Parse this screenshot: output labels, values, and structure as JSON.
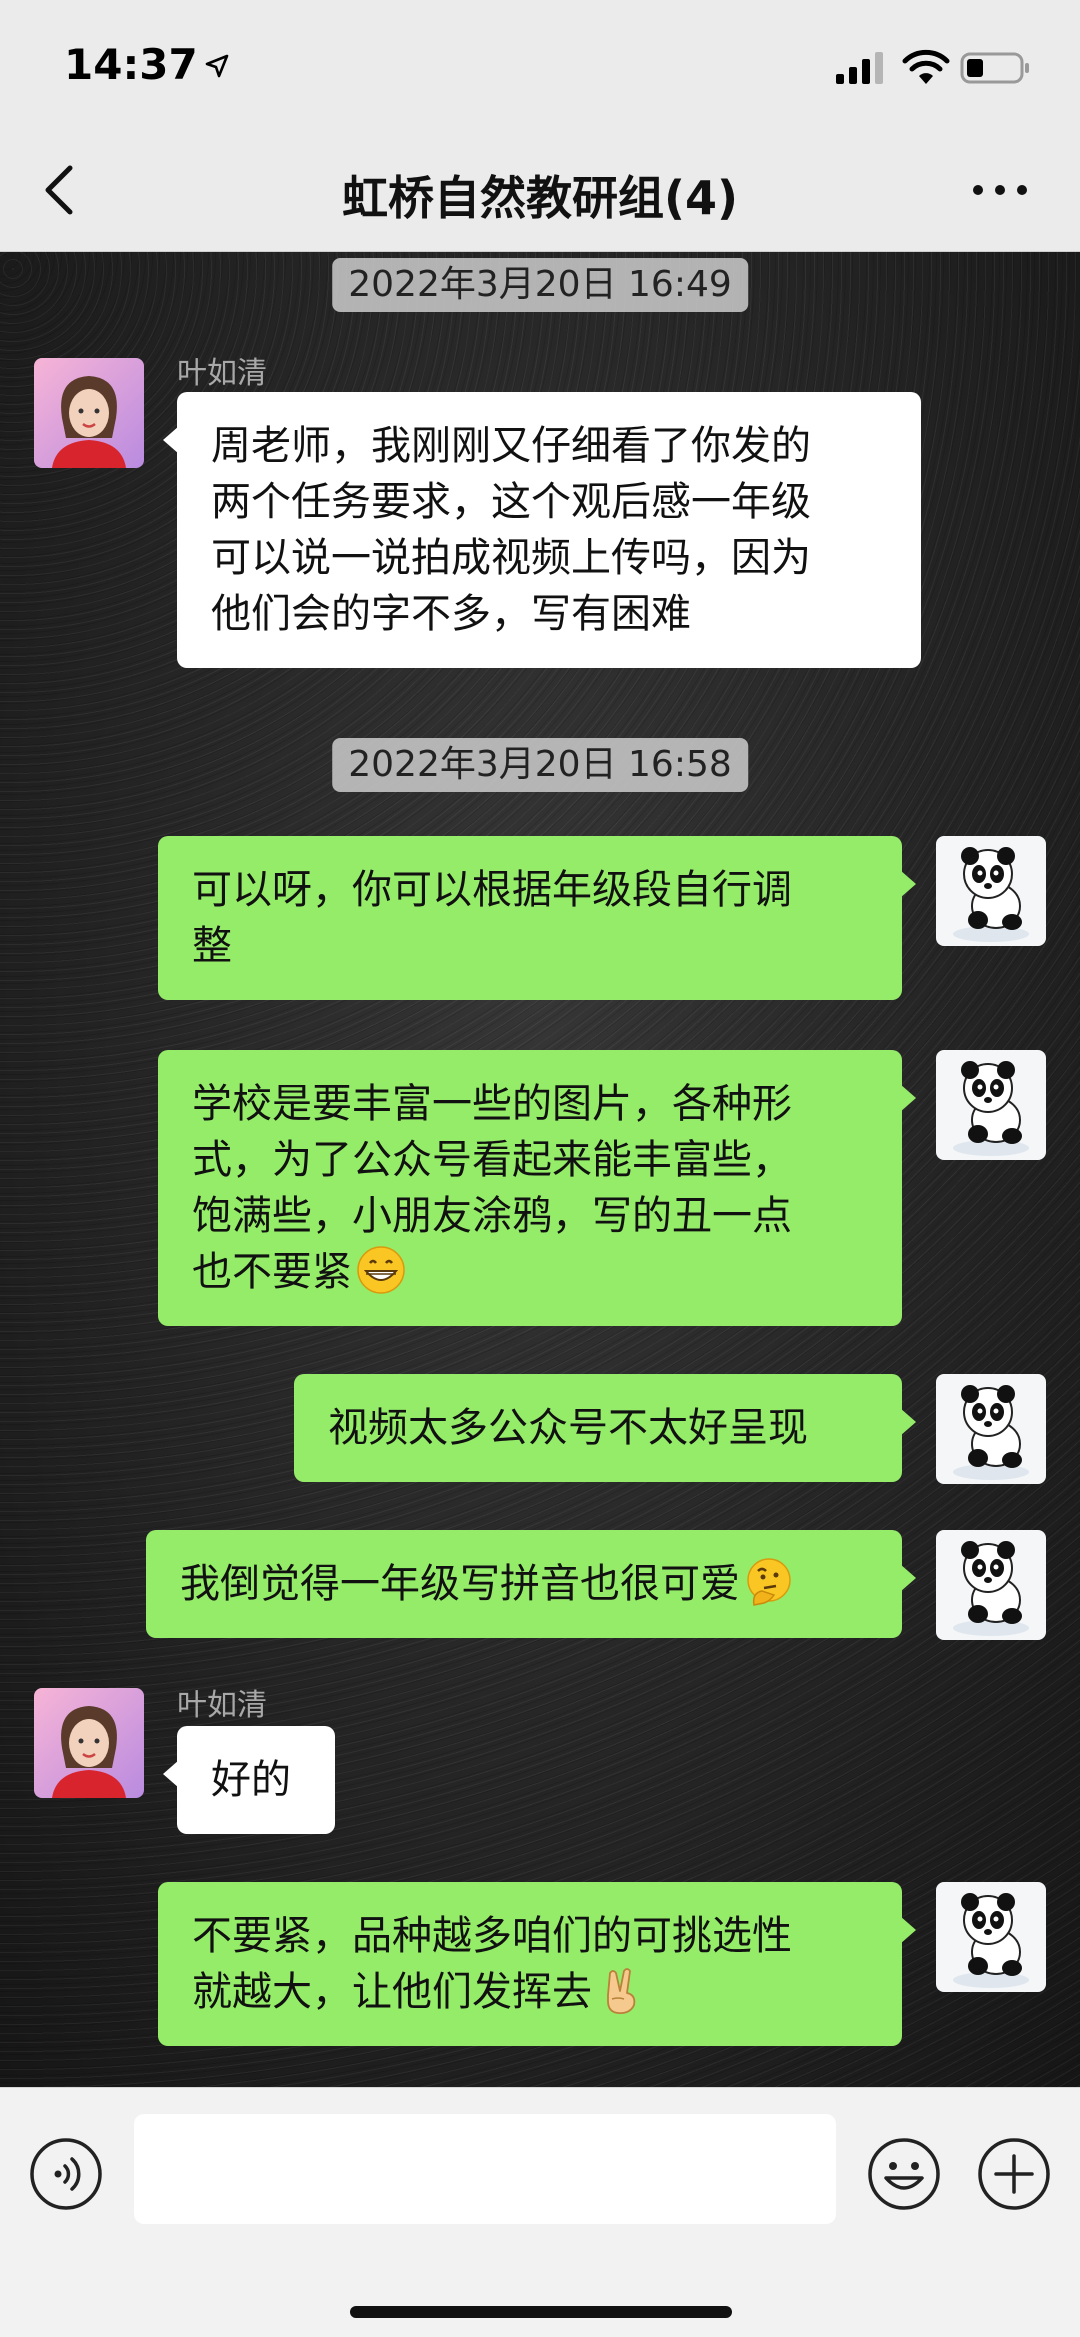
{
  "status_bar": {
    "time": "14:37",
    "icons": [
      "location-arrow-icon",
      "cellular-signal-icon",
      "wifi-icon",
      "battery-icon"
    ]
  },
  "header": {
    "title": "虹桥自然教研组(4)",
    "back_icon": "chevron-left-icon",
    "more_icon": "more-dots-icon"
  },
  "messages": {
    "ts1": "2022年3月20日 16:49",
    "m1_sender": "叶如清",
    "m1_lines": [
      "周老师，我刚刚又仔细看了你发的",
      "两个任务要求，这个观后感一年级",
      "可以说一说拍成视频上传吗，因为",
      "他们会的字不多，写有困难"
    ],
    "ts2": "2022年3月20日 16:58",
    "m2_lines": [
      "可以呀，你可以根据年级段自行调",
      "整"
    ],
    "m3_lines": [
      "学校是要丰富一些的图片，各种形",
      "式，为了公众号看起来能丰富些，",
      "饱满些，小朋友涂鸦，写的丑一点",
      "也不要紧"
    ],
    "m3_emoji": "grinning-face-emoji",
    "m4_text": "视频太多公众号不太好呈现",
    "m5_text": "我倒觉得一年级写拼音也很可爱",
    "m5_emoji": "thinking-face-emoji",
    "m6_sender": "叶如清",
    "m6_text": "好的",
    "m7_lines": [
      "不要紧，品种越多咱们的可挑选性",
      "就越大，让他们发挥去"
    ],
    "m7_emoji": "victory-hand-emoji"
  },
  "input_bar": {
    "voice_icon": "voice-input-icon",
    "text_value": "",
    "emoji_icon": "emoji-smile-icon",
    "plus_icon": "plus-circle-icon"
  },
  "colors": {
    "sent_bubble": "#95ec69",
    "received_bubble": "#ffffff",
    "header_bg": "#ebebeb",
    "input_bg": "#f2f2f2"
  }
}
